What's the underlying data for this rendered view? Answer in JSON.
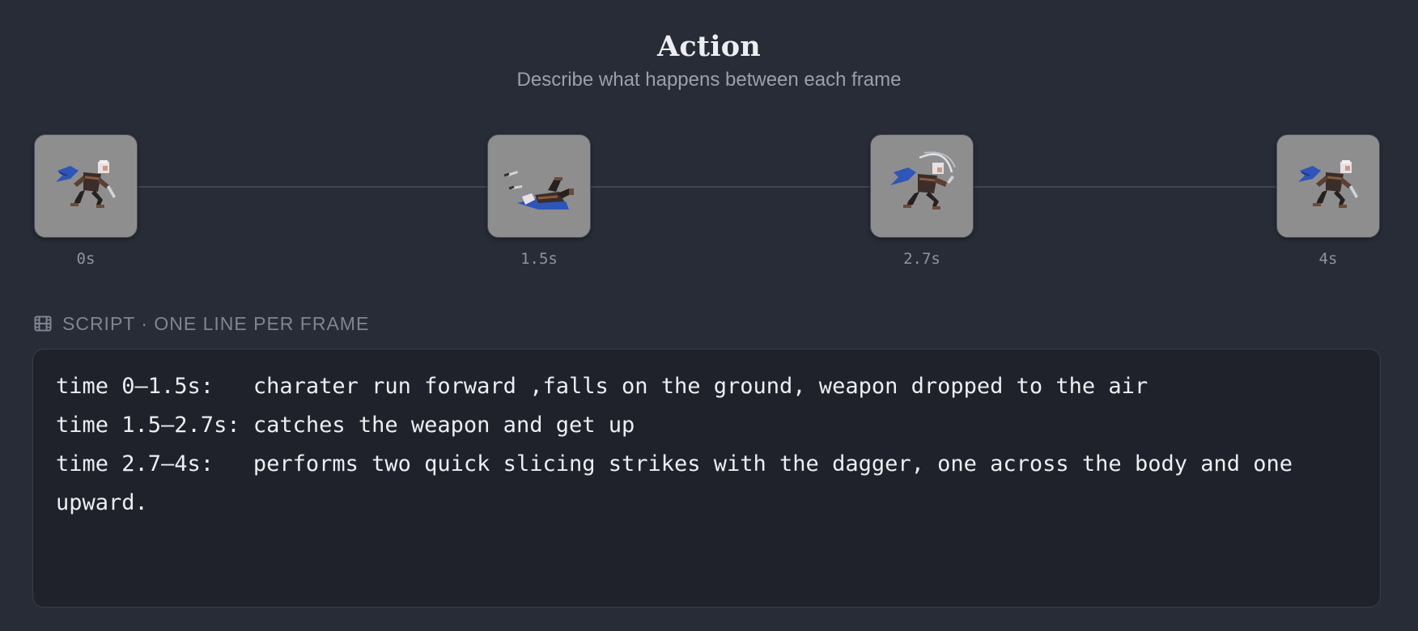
{
  "header": {
    "title": "Action",
    "subtitle": "Describe what happens between each frame"
  },
  "timeline": {
    "frames": [
      {
        "time": "0s",
        "pose": "running-character-icon"
      },
      {
        "time": "1.5s",
        "pose": "fallen-character-icon"
      },
      {
        "time": "2.7s",
        "pose": "slashing-character-icon"
      },
      {
        "time": "4s",
        "pose": "running-character-icon"
      }
    ]
  },
  "script": {
    "icon": "film-icon",
    "label": "SCRIPT · ONE LINE PER FRAME",
    "lines": [
      "time 0–1.5s:   charater run forward ,falls on the ground, weapon dropped to the air",
      "time 1.5–2.7s: catches the weapon and get up",
      "time 2.7–4s:   performs two quick slicing strikes with the dagger, one across the body and one upward."
    ]
  },
  "colors": {
    "background": "#282c36",
    "script_background": "#1f222a",
    "thumbnail_background": "#8e8e8e",
    "scarf": "#2e56b8"
  }
}
